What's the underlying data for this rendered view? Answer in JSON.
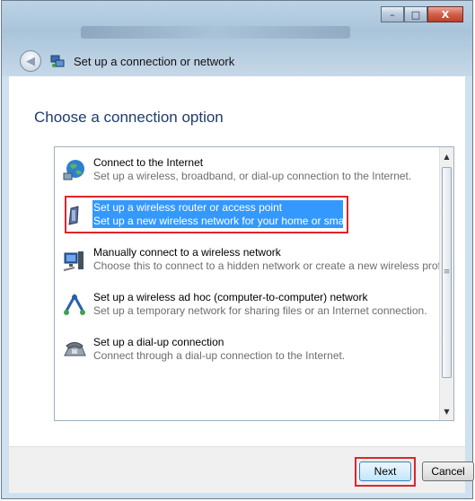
{
  "window": {
    "nav_title": "Set up a connection or network",
    "caption": {
      "minimize": "–",
      "maximize": "□",
      "close": "X"
    }
  },
  "main": {
    "heading": "Choose a connection option",
    "options": [
      {
        "title": "Connect to the Internet",
        "desc": "Set up a wireless, broadband, or dial-up connection to the Internet.",
        "icon": "globe-network-icon",
        "selected": false
      },
      {
        "title": "Set up a wireless router or access point",
        "desc": "Set up a new wireless network for your home or small business.",
        "icon": "wireless-router-icon",
        "selected": true
      },
      {
        "title": "Manually connect to a wireless network",
        "desc": "Choose this to connect to a hidden network or create a new wireless profile.",
        "icon": "wireless-computer-icon",
        "selected": false
      },
      {
        "title": "Set up a wireless ad hoc (computer-to-computer) network",
        "desc": "Set up a temporary network for sharing files or an Internet connection.",
        "icon": "adhoc-network-icon",
        "selected": false
      },
      {
        "title": "Set up a dial-up connection",
        "desc": "Connect through a dial-up connection to the Internet.",
        "icon": "dialup-phone-icon",
        "selected": false
      }
    ]
  },
  "footer": {
    "next_label": "Next",
    "cancel_label": "Cancel"
  },
  "colors": {
    "selection": "#3399ff",
    "highlight_frame": "#e0242a",
    "heading": "#1e3c6e"
  }
}
